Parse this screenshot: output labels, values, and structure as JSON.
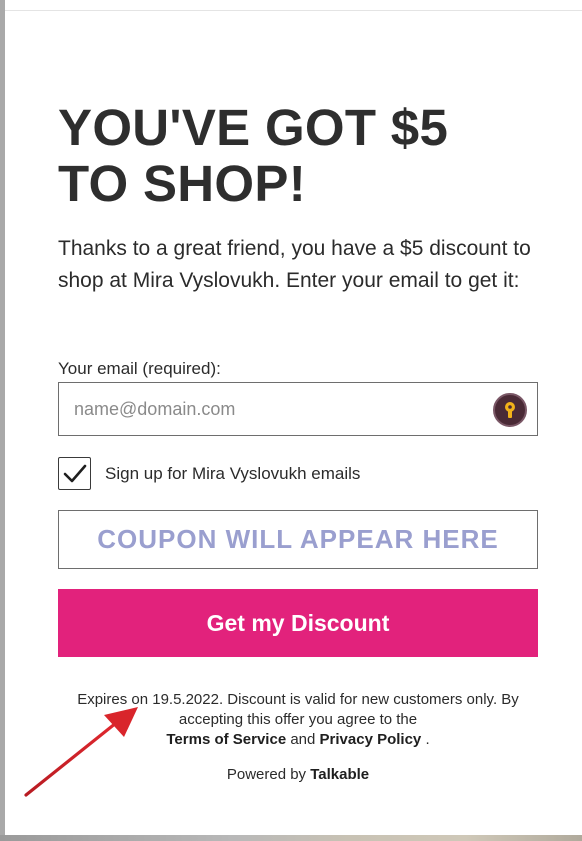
{
  "offer": {
    "headline": "YOU'VE GOT $5 TO SHOP!",
    "intro": "Thanks to a great friend, you have a $5 discount to shop at Mira Vyslovukh. Enter your email to get it:"
  },
  "form": {
    "email_label": "Your email (required):",
    "email_placeholder": "name@domain.com",
    "email_value": "",
    "signup_label": "Sign up for Mira Vyslovukh emails",
    "signup_checked": true,
    "coupon_placeholder": "COUPON WILL APPEAR HERE",
    "submit_label": "Get my Discount"
  },
  "footer": {
    "terms_text_1": "Expires on 19.5.2022. Discount is valid for new customers only. By accepting this offer you agree to the",
    "terms_link": "Terms of Service",
    "terms_and": "and",
    "privacy_link": "Privacy Policy",
    "terms_end": ".",
    "powered_prefix": "Powered by",
    "powered_brand": "Talkable"
  },
  "icons": {
    "password_manager": "key-icon",
    "checkbox": "checkmark-icon",
    "annotation": "red-arrow-annotation"
  },
  "colors": {
    "cta_background": "#e2227c",
    "coupon_text": "#9a9fcf",
    "key_icon_bg": "#4a2a36",
    "arrow": "#d9252b"
  }
}
